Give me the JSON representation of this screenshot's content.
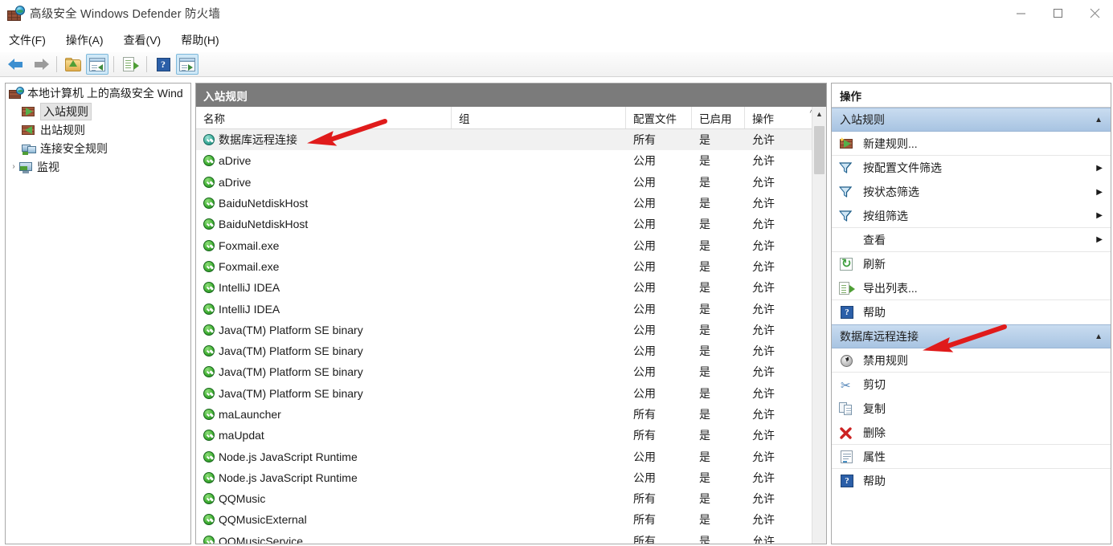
{
  "window": {
    "title": "高级安全 Windows Defender 防火墙",
    "icon": "firewall-globe-icon",
    "controls": {
      "minimize": "—",
      "maximize": "□",
      "close": "✕"
    }
  },
  "menubar": {
    "items": [
      {
        "label": "文件(F)",
        "name": "menu-file"
      },
      {
        "label": "操作(A)",
        "name": "menu-action"
      },
      {
        "label": "查看(V)",
        "name": "menu-view"
      },
      {
        "label": "帮助(H)",
        "name": "menu-help"
      }
    ]
  },
  "toolbar": {
    "buttons": [
      {
        "name": "back-button",
        "icon": "arrow-back-icon",
        "active": false
      },
      {
        "name": "forward-button",
        "icon": "arrow-forward-icon",
        "active": false
      },
      {
        "name": "up-one-level-button",
        "icon": "folder-up-icon",
        "active": false
      },
      {
        "name": "show-hide-tree-button",
        "icon": "window-pane-left-icon",
        "active": true
      },
      {
        "name": "export-list-button",
        "icon": "export-list-icon",
        "active": false
      },
      {
        "name": "help-button",
        "icon": "help-question-icon",
        "active": false
      },
      {
        "name": "show-hide-action-pane-button",
        "icon": "window-pane-right-icon",
        "active": true
      }
    ]
  },
  "tree": {
    "items": [
      {
        "label": "本地计算机 上的高级安全 Wind",
        "icon": "firewall-root-icon",
        "level": 0,
        "selected": false,
        "chevron": ""
      },
      {
        "label": "入站规则",
        "icon": "inbound-rule-icon",
        "level": 1,
        "selected": true,
        "chevron": ""
      },
      {
        "label": "出站规则",
        "icon": "outbound-rule-icon",
        "level": 1,
        "selected": false,
        "chevron": ""
      },
      {
        "label": "连接安全规则",
        "icon": "connection-security-icon",
        "level": 1,
        "selected": false,
        "chevron": ""
      },
      {
        "label": "监视",
        "icon": "monitoring-icon",
        "level": 1,
        "selected": false,
        "chevron": "›"
      }
    ]
  },
  "list": {
    "caption": "入站规则",
    "columns": [
      "名称",
      "组",
      "配置文件",
      "已启用",
      "操作"
    ],
    "scroll_cap": "^",
    "rows": [
      {
        "name": "数据库远程连接",
        "group": "",
        "profile": "所有",
        "enabled": "是",
        "action": "允许",
        "selected": true
      },
      {
        "name": "aDrive",
        "group": "",
        "profile": "公用",
        "enabled": "是",
        "action": "允许",
        "selected": false
      },
      {
        "name": "aDrive",
        "group": "",
        "profile": "公用",
        "enabled": "是",
        "action": "允许",
        "selected": false
      },
      {
        "name": "BaiduNetdiskHost",
        "group": "",
        "profile": "公用",
        "enabled": "是",
        "action": "允许",
        "selected": false
      },
      {
        "name": "BaiduNetdiskHost",
        "group": "",
        "profile": "公用",
        "enabled": "是",
        "action": "允许",
        "selected": false
      },
      {
        "name": "Foxmail.exe",
        "group": "",
        "profile": "公用",
        "enabled": "是",
        "action": "允许",
        "selected": false
      },
      {
        "name": "Foxmail.exe",
        "group": "",
        "profile": "公用",
        "enabled": "是",
        "action": "允许",
        "selected": false
      },
      {
        "name": "IntelliJ IDEA",
        "group": "",
        "profile": "公用",
        "enabled": "是",
        "action": "允许",
        "selected": false
      },
      {
        "name": "IntelliJ IDEA",
        "group": "",
        "profile": "公用",
        "enabled": "是",
        "action": "允许",
        "selected": false
      },
      {
        "name": "Java(TM) Platform SE binary",
        "group": "",
        "profile": "公用",
        "enabled": "是",
        "action": "允许",
        "selected": false
      },
      {
        "name": "Java(TM) Platform SE binary",
        "group": "",
        "profile": "公用",
        "enabled": "是",
        "action": "允许",
        "selected": false
      },
      {
        "name": "Java(TM) Platform SE binary",
        "group": "",
        "profile": "公用",
        "enabled": "是",
        "action": "允许",
        "selected": false
      },
      {
        "name": "Java(TM) Platform SE binary",
        "group": "",
        "profile": "公用",
        "enabled": "是",
        "action": "允许",
        "selected": false
      },
      {
        "name": "maLauncher",
        "group": "",
        "profile": "所有",
        "enabled": "是",
        "action": "允许",
        "selected": false
      },
      {
        "name": "maUpdat",
        "group": "",
        "profile": "所有",
        "enabled": "是",
        "action": "允许",
        "selected": false
      },
      {
        "name": "Node.js JavaScript Runtime",
        "group": "",
        "profile": "公用",
        "enabled": "是",
        "action": "允许",
        "selected": false
      },
      {
        "name": "Node.js JavaScript Runtime",
        "group": "",
        "profile": "公用",
        "enabled": "是",
        "action": "允许",
        "selected": false
      },
      {
        "name": "QQMusic",
        "group": "",
        "profile": "所有",
        "enabled": "是",
        "action": "允许",
        "selected": false
      },
      {
        "name": "QQMusicExternal",
        "group": "",
        "profile": "所有",
        "enabled": "是",
        "action": "允许",
        "selected": false
      },
      {
        "name": "QQMusicService",
        "group": "",
        "profile": "所有",
        "enabled": "是",
        "action": "允许",
        "selected": false
      }
    ]
  },
  "actions": {
    "caption": "操作",
    "groups": [
      {
        "title": "入站规则",
        "name": "actions-group-inbound-rules",
        "chevron": "▲",
        "items": [
          {
            "label": "新建规则...",
            "icon": "new-rule-icon",
            "submenu": "",
            "divider": true
          },
          {
            "label": "按配置文件筛选",
            "icon": "filter-icon",
            "submenu": "▶",
            "divider": false
          },
          {
            "label": "按状态筛选",
            "icon": "filter-icon",
            "submenu": "▶",
            "divider": false
          },
          {
            "label": "按组筛选",
            "icon": "filter-icon",
            "submenu": "▶",
            "divider": true
          },
          {
            "label": "查看",
            "icon": "",
            "submenu": "▶",
            "divider": true
          },
          {
            "label": "刷新",
            "icon": "refresh-icon",
            "submenu": "",
            "divider": false
          },
          {
            "label": "导出列表...",
            "icon": "export-list-icon",
            "submenu": "",
            "divider": true
          },
          {
            "label": "帮助",
            "icon": "help-question-icon",
            "submenu": "",
            "divider": false
          }
        ]
      },
      {
        "title": "数据库远程连接",
        "name": "actions-group-selected-rule",
        "chevron": "▲",
        "items": [
          {
            "label": "禁用规则",
            "icon": "disable-rule-icon",
            "submenu": "",
            "divider": true
          },
          {
            "label": "剪切",
            "icon": "cut-icon",
            "submenu": "",
            "divider": false
          },
          {
            "label": "复制",
            "icon": "copy-icon",
            "submenu": "",
            "divider": false
          },
          {
            "label": "删除",
            "icon": "delete-x-icon",
            "submenu": "",
            "divider": true
          },
          {
            "label": "属性",
            "icon": "properties-icon",
            "submenu": "",
            "divider": true
          },
          {
            "label": "帮助",
            "icon": "help-question-icon",
            "submenu": "",
            "divider": false
          }
        ]
      }
    ]
  },
  "annotations": [
    {
      "name": "annotation-arrow-rule-row",
      "color": "#e01b1b",
      "points_to": "数据库远程连接"
    },
    {
      "name": "annotation-arrow-actions-group",
      "color": "#e01b1b",
      "points_to": "数据库远程连接"
    }
  ],
  "colors": {
    "accent_blue": "#a8c4e2",
    "caption_gray": "#7b7b7b",
    "annotation_red": "#e01b1b",
    "shield_green": "#43b035"
  }
}
